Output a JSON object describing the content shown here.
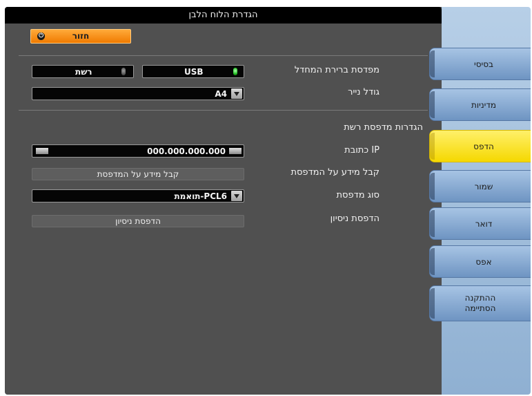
{
  "window": {
    "title": "הגדרת הלוח הלבן"
  },
  "back_button": {
    "label": "חזור"
  },
  "printer_select": {
    "label": "מפדסת ברירת המחדל",
    "usb_label": "USB",
    "network_label": "רשת",
    "selected": "USB"
  },
  "paper_size": {
    "label": "גודל נייר",
    "value": "A4"
  },
  "network_section": {
    "header": "הגדרות מדפסת רשת",
    "ip": {
      "label": "כתובת IP",
      "value": "000.000.000.000"
    },
    "printer_info": {
      "label": "קבל מידע על המדפסת",
      "button": "קבל מידע על המדפסת"
    },
    "printer_type": {
      "label": "סוג מדפסת",
      "value": "תואמת-PCL6"
    },
    "test_print": {
      "label": "הדפסת ניסיון",
      "button": "הדפסת ניסיון"
    }
  },
  "tabs": [
    {
      "label": "בסיסי",
      "active": false
    },
    {
      "label": "מדיניות",
      "active": false
    },
    {
      "label": "הדפס",
      "active": true
    },
    {
      "label": "שמור",
      "active": false
    },
    {
      "label": "דואר",
      "active": false
    },
    {
      "label": "אפס",
      "active": false
    },
    {
      "label": "ההתקנה הסתיימה",
      "active": false
    }
  ],
  "colors": {
    "active_tab": "#f5d800",
    "back_button": "#f07a00",
    "led_on": "#25c025"
  }
}
